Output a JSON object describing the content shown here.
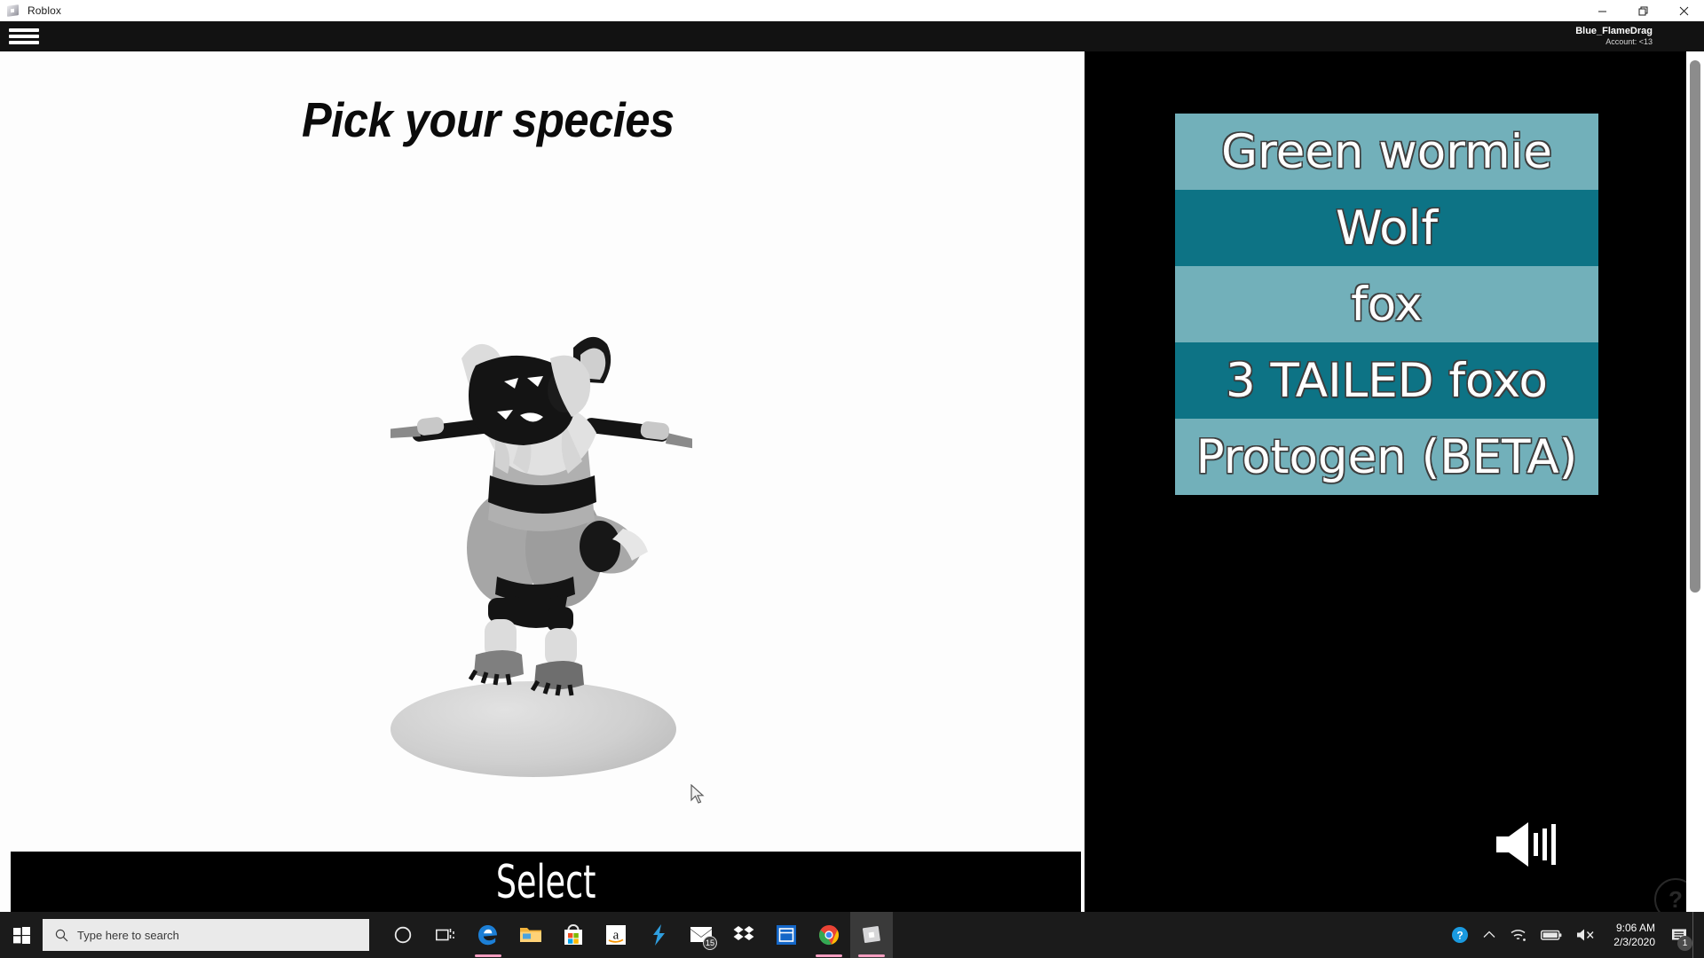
{
  "window": {
    "app_title": "Roblox",
    "app_icon": "roblox-logo-icon",
    "minimize_label": "Minimize",
    "restore_label": "Restore",
    "close_label": "Close"
  },
  "roblox_topbar": {
    "menu_icon": "hamburger-menu-icon",
    "account_name": "Blue_FlameDrag",
    "account_age": "Account: <13"
  },
  "game": {
    "title": "Pick your species",
    "select_button": "Select",
    "sound_icon": "speaker-on-icon",
    "help_label": "?",
    "species_list": [
      {
        "label": "Green wormie",
        "color": "#72b0ba"
      },
      {
        "label": "Wolf",
        "color": "#0d7385"
      },
      {
        "label": "fox",
        "color": "#72b0ba"
      },
      {
        "label": "3 TAILED foxo",
        "color": "#0d7385"
      },
      {
        "label": "Protogen (BETA)",
        "color": "#72b0ba"
      }
    ],
    "colors": {
      "list_light": "#72b0ba",
      "list_dark": "#0d7385",
      "stage_bg": "#fdfdfd",
      "panel_bg": "#000000"
    }
  },
  "taskbar": {
    "start_icon": "windows-start-icon",
    "search_placeholder": "Type here to search",
    "search_icon": "search-magnifier-icon",
    "items": [
      {
        "name": "cortana-icon",
        "label": "Cortana",
        "badge": "",
        "active": false,
        "underline": false
      },
      {
        "name": "task-view-icon",
        "label": "Task View",
        "badge": "",
        "active": false,
        "underline": false
      },
      {
        "name": "microsoft-edge-icon",
        "label": "Microsoft Edge",
        "badge": "",
        "active": false,
        "underline": true
      },
      {
        "name": "file-explorer-icon",
        "label": "File Explorer",
        "badge": "",
        "active": false,
        "underline": false
      },
      {
        "name": "microsoft-store-icon",
        "label": "Microsoft Store",
        "badge": "",
        "active": false,
        "underline": false
      },
      {
        "name": "amazon-icon",
        "label": "Amazon",
        "badge": "",
        "active": false,
        "underline": false
      },
      {
        "name": "lightning-app-icon",
        "label": "Lightning app",
        "badge": "",
        "active": false,
        "underline": false
      },
      {
        "name": "mail-icon",
        "label": "Mail",
        "badge": "15",
        "active": false,
        "underline": false
      },
      {
        "name": "dropbox-icon",
        "label": "Dropbox",
        "badge": "",
        "active": false,
        "underline": false
      },
      {
        "name": "window-app-icon",
        "label": "Window app",
        "badge": "",
        "active": false,
        "underline": false
      },
      {
        "name": "google-chrome-icon",
        "label": "Google Chrome",
        "badge": "",
        "active": false,
        "underline": true
      },
      {
        "name": "roblox-icon",
        "label": "Roblox",
        "badge": "",
        "active": true,
        "underline": true
      }
    ],
    "tray": {
      "help_icon": "question-help-icon",
      "chevron_icon": "chevron-up-icon",
      "network_icon": "wifi-icon",
      "battery_icon": "battery-icon",
      "volume_icon": "speaker-muted-icon",
      "time": "9:06 AM",
      "date": "2/3/2020",
      "notification_icon": "notification-icon",
      "notification_count": "1"
    }
  }
}
